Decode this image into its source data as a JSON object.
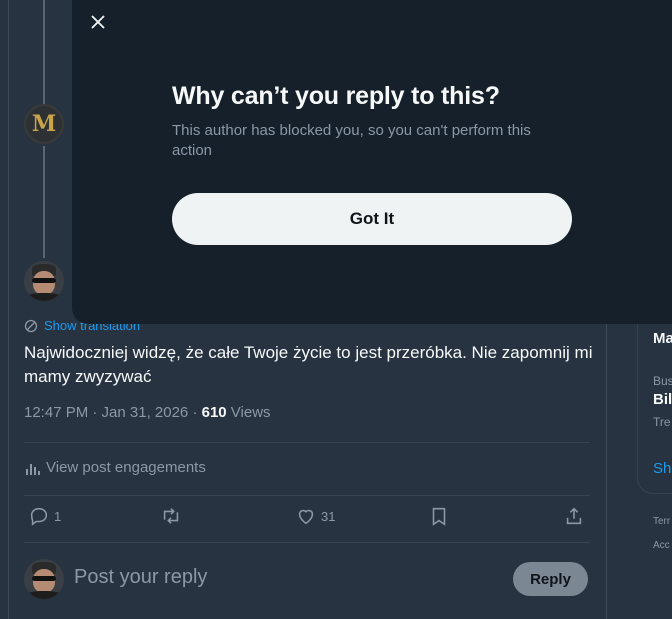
{
  "modal": {
    "title": "Why can’t you reply to this?",
    "description": "This author has blocked you, so you can't perform this action",
    "button_label": "Got It",
    "close_icon": "close-icon"
  },
  "post": {
    "show_translation": "Show translation",
    "text": "Najwidoczniej widzę, że całe Twoje życie to jest przeróbka. Nie zapomnij mi mamy zwyzywać",
    "time": "12:47 PM · Jan 31, 2026 · ",
    "views_count": "610",
    "views_label": " Views",
    "engagements_label": "View post engagements",
    "reply_count": "1",
    "like_count": "31"
  },
  "reply_box": {
    "placeholder": "Post your reply",
    "button_label": "Reply"
  },
  "sidebar": {
    "avatar_letter": "M",
    "right_texts": [
      "Ma",
      "Bus",
      "Bil",
      "Tre",
      "Sh",
      "Terr",
      "Acc"
    ]
  },
  "colors": {
    "accent": "#1d9bf0",
    "modal_bg": "#15202b",
    "page_dim": "#273340",
    "button_bg": "#eff3f4"
  }
}
